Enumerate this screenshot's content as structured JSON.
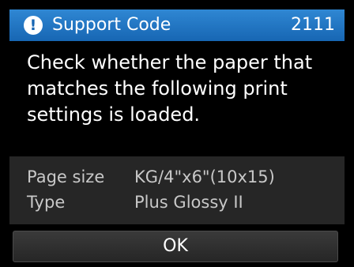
{
  "title_bar": {
    "icon": "exclamation-circle-icon",
    "icon_glyph": "!",
    "title": "Support Code",
    "code": "2111",
    "color": "#1766b3"
  },
  "message": "Check whether the paper that matches the following print settings is loaded.",
  "settings": [
    {
      "label": "Page size",
      "value": "KG/4\"x6\"(10x15)"
    },
    {
      "label": "Type",
      "value": "Plus Glossy II"
    }
  ],
  "ok_button": {
    "label": "OK"
  }
}
